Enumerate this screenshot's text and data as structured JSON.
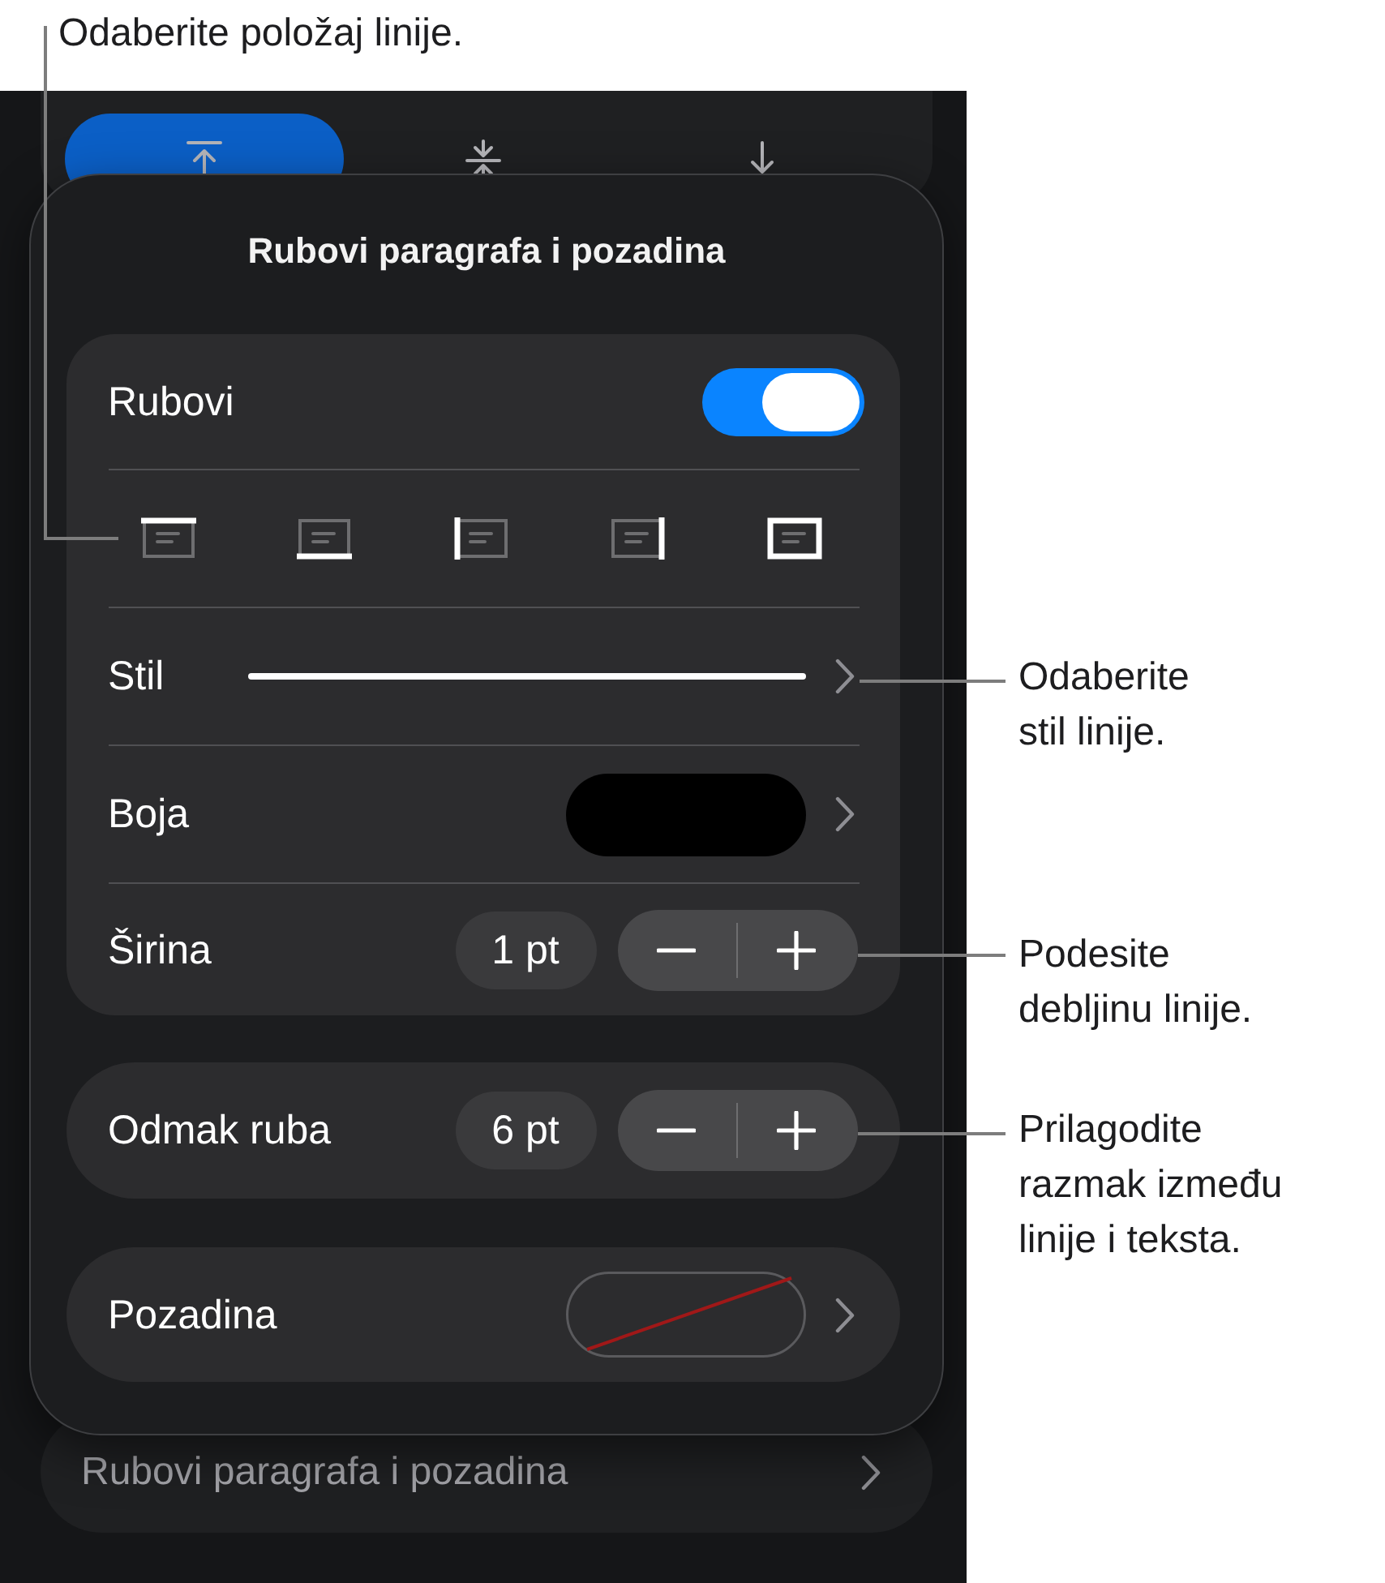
{
  "callouts": [
    {
      "text": "Odaberite položaj linije."
    },
    {
      "text": "Odaberite\nstil linije."
    },
    {
      "text": "Podesite\ndebljinu linije."
    },
    {
      "text": "Prilagodite\nrazmak između\nlinije i teksta."
    }
  ],
  "alignment_tabs": [
    {
      "kind": "top",
      "selected": true
    },
    {
      "kind": "middle",
      "selected": false
    },
    {
      "kind": "bottom",
      "selected": false
    }
  ],
  "popover": {
    "title": "Rubovi paragrafa i pozadina",
    "borders": {
      "label": "Rubovi",
      "on": true
    },
    "border_positions": [
      {
        "kind": "top"
      },
      {
        "kind": "bottom"
      },
      {
        "kind": "left"
      },
      {
        "kind": "right"
      },
      {
        "kind": "box"
      }
    ],
    "style": {
      "label": "Stil"
    },
    "color": {
      "label": "Boja",
      "color": "#000000"
    },
    "width": {
      "label": "Širina",
      "value": "1 pt"
    },
    "spacing": {
      "label": "Odmak ruba",
      "value": "6 pt"
    },
    "background": {
      "label": "Pozadina"
    }
  },
  "behind_row": {
    "label": "Rubovi paragrafa i pozadina"
  }
}
